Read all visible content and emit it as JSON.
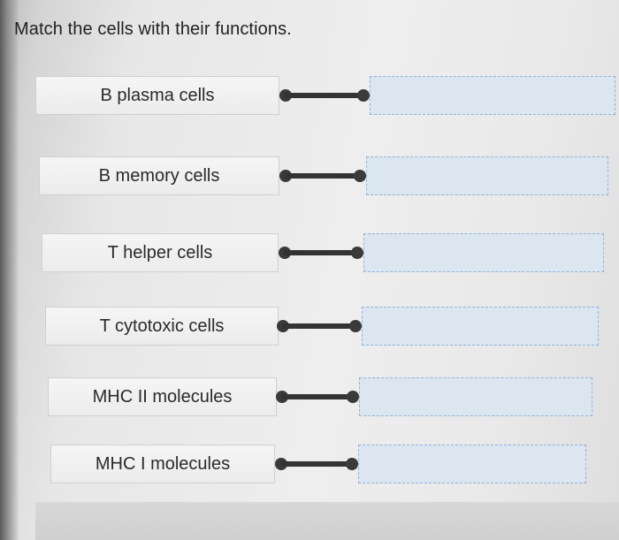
{
  "question": "Match the cells with their functions.",
  "items": [
    {
      "term": "B plasma cells",
      "answer": ""
    },
    {
      "term": "B memory cells",
      "answer": ""
    },
    {
      "term": "T helper cells",
      "answer": ""
    },
    {
      "term": "T cytotoxic cells",
      "answer": ""
    },
    {
      "term": "MHC II molecules",
      "answer": ""
    },
    {
      "term": "MHC I molecules",
      "answer": ""
    }
  ],
  "colors": {
    "drop_zone_fill": "#dce6f0",
    "drop_zone_border": "#8fb2d6",
    "connector": "#333333"
  }
}
